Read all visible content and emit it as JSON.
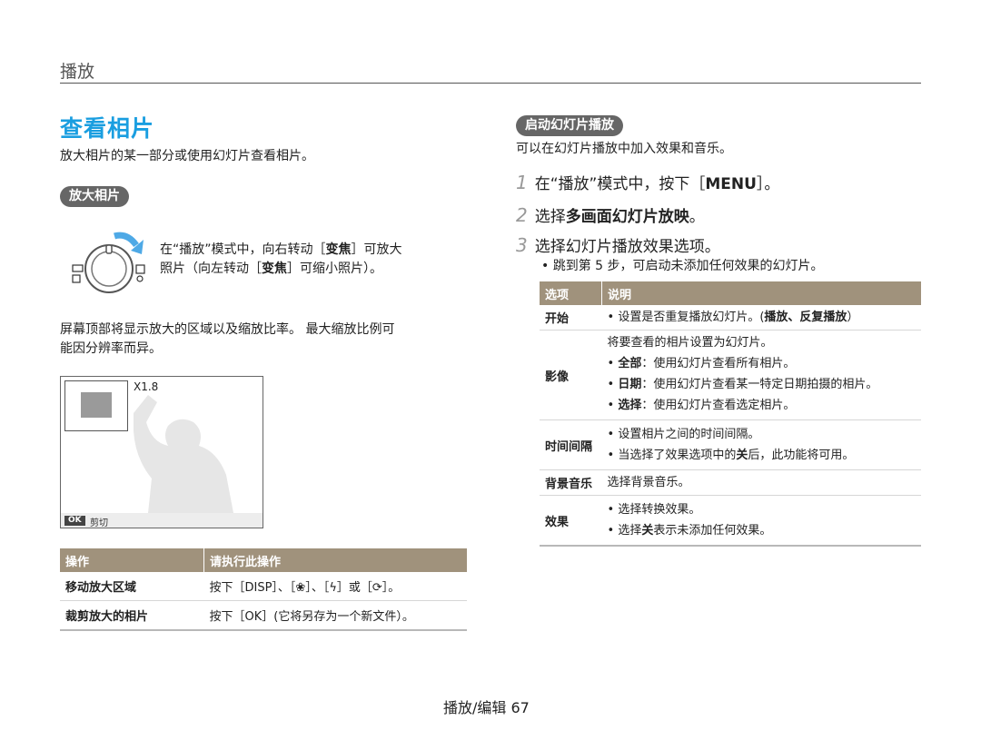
{
  "header": {
    "chapter": "播放"
  },
  "left": {
    "title": "查看相片",
    "intro": "放大相片的某一部分或使用幻灯片查看相片。",
    "zoom_tag": "放大相片",
    "dial_line1_pre": "在“播放”模式中，向右转动［",
    "dial_key": "变焦",
    "dial_line1_post": "］可放大",
    "dial_line2_pre": "照片（向左转动［",
    "dial_line2_post": "］可缩小照片）。",
    "screen_note_line1": "屏幕顶部将显示放大的区域以及缩放比率。 最大缩放比例可",
    "screen_note_line2": "能因分辨率而异。",
    "preview": {
      "ratio": "X1.8",
      "ok_key": "OK",
      "ok_label": "剪切"
    },
    "ops_table": {
      "headers": [
        "操作",
        "请执行此操作"
      ],
      "rows": [
        {
          "op": "移动放大区域",
          "action": "按下［DISP］、［❀］、［ϟ］或［⟳］。"
        },
        {
          "op": "裁剪放大的相片",
          "action": "按下［OK］(它将另存为一个新文件）。"
        }
      ]
    }
  },
  "right": {
    "slideshow_tag": "启动幻灯片播放",
    "intro": "可以在幻灯片播放中加入效果和音乐。",
    "steps": [
      {
        "num": "1",
        "pre": "在“播放”模式中，按下［",
        "key": "MENU",
        "post": "］。"
      },
      {
        "num": "2",
        "pre": "选择",
        "key": "多画面幻灯片放映",
        "post": "。"
      },
      {
        "num": "3",
        "pre": "选择幻灯片播放效果选项。",
        "key": "",
        "post": ""
      }
    ],
    "step3_note": "跳到第 5 步，可启动未添加任何效果的幻灯片。",
    "options_table": {
      "headers": [
        "选项",
        "说明"
      ],
      "rows": [
        {
          "option": "开始",
          "desc_pre": "设置是否重复播放幻灯片。(",
          "desc_bold": "播放、反复播放",
          "desc_post": "）"
        },
        {
          "option": "影像",
          "desc_intro": "将要查看的相片设置为幻灯片。",
          "bullets": [
            {
              "bold": "全部",
              "text": "：使用幻灯片查看所有相片。"
            },
            {
              "bold": "日期",
              "text": "：使用幻灯片查看某一特定日期拍摄的相片。"
            },
            {
              "bold": "选择",
              "text": "：使用幻灯片查看选定相片。"
            }
          ]
        },
        {
          "option": "时间间隔",
          "bullets": [
            {
              "text": "设置相片之间的时间间隔。"
            },
            {
              "pre": "当选择了效果选项中的",
              "bold": "关",
              "text": "后，此功能将可用。"
            }
          ]
        },
        {
          "option": "背景音乐",
          "desc": "选择背景音乐。"
        },
        {
          "option": "效果",
          "bullets": [
            {
              "text": "选择转换效果。"
            },
            {
              "pre": "选择",
              "bold": "关",
              "text": "表示未添加任何效果。"
            }
          ]
        }
      ]
    }
  },
  "footer": {
    "text": "播放/编辑  67"
  }
}
